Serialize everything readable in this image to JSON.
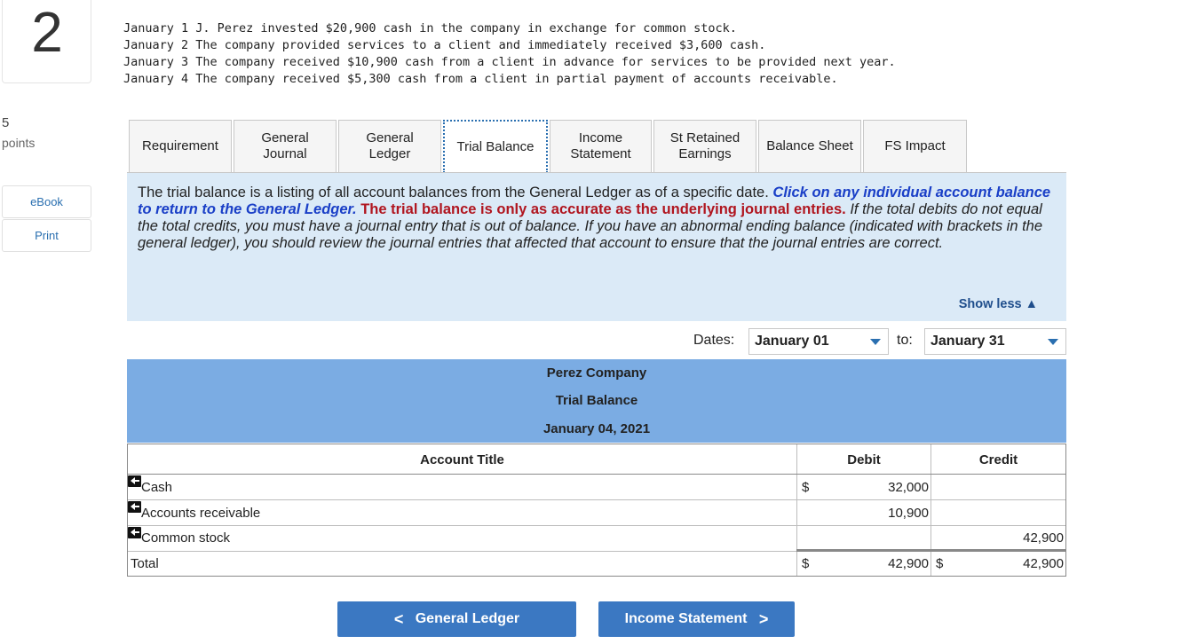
{
  "question": {
    "number": "2",
    "points_value": "5",
    "points_label": "points"
  },
  "side_buttons": {
    "ebook": "eBook",
    "print": "Print"
  },
  "transactions": [
    "January 1 J. Perez invested $20,900 cash in the company in exchange for common stock.",
    "January 2 The company provided services to a client and immediately received $3,600 cash.",
    "January 3 The company received $10,900 cash from a client in advance for services to be provided next year.",
    "January 4 The company received $5,300 cash from a client in partial payment of accounts receivable."
  ],
  "tabs": [
    {
      "l1": "Requirement",
      "l2": ""
    },
    {
      "l1": "General",
      "l2": "Journal"
    },
    {
      "l1": "General",
      "l2": "Ledger"
    },
    {
      "l1": "Trial Balance",
      "l2": ""
    },
    {
      "l1": "Income",
      "l2": "Statement"
    },
    {
      "l1": "St Retained",
      "l2": "Earnings"
    },
    {
      "l1": "Balance Sheet",
      "l2": ""
    },
    {
      "l1": "FS Impact",
      "l2": ""
    }
  ],
  "info": {
    "p1": "The trial balance is a listing of all account balances from the General Ledger as of a specific date.",
    "p2": "Click on any individual account balance to return to the General Ledger.",
    "p3": "The trial balance is only as accurate as the underlying journal entries.",
    "p4": "If the total debits do not equal the total credits, you must have a journal entry that is out of balance.  If you have an abnormal ending balance (indicated with brackets in the general ledger), you should review the journal entries that affected that account to ensure that the journal entries are correct.",
    "show_less": "Show less"
  },
  "dates": {
    "label": "Dates:",
    "from": "January 01",
    "to_label": "to:",
    "to": "January 31"
  },
  "trial_balance": {
    "company": "Perez Company",
    "title": "Trial Balance",
    "date": "January 04, 2021",
    "headers": {
      "account": "Account Title",
      "debit": "Debit",
      "credit": "Credit"
    },
    "rows": [
      {
        "account": "Cash",
        "debit_sign": "$",
        "debit": "32,000",
        "credit": ""
      },
      {
        "account": "Accounts receivable",
        "debit_sign": "",
        "debit": "10,900",
        "credit": ""
      },
      {
        "account": "Common stock",
        "debit_sign": "",
        "debit": "",
        "credit": "42,900"
      }
    ],
    "total": {
      "label": "Total",
      "debit_sign": "$",
      "debit": "42,900",
      "credit_sign": "$",
      "credit": "42,900"
    }
  },
  "nav": {
    "prev": "General Ledger",
    "next": "Income Statement",
    "prev_glyph": "<",
    "next_glyph": ">"
  }
}
